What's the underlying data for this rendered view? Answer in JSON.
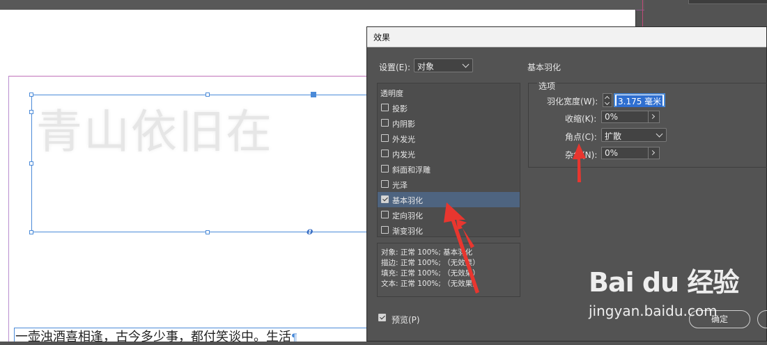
{
  "document": {
    "feathered_text": "青山依旧在",
    "body_text": "一壶浊酒喜相逢，古今多少事，都付笑谈中。生活",
    "paragraph_mark": "¶",
    "anchor_mark": "o"
  },
  "dialog": {
    "title": "效果",
    "settings_label": "设置(E):",
    "settings_value": "对象",
    "section_title": "基本羽化",
    "effects": [
      {
        "label": "透明度",
        "checked": null,
        "selected": false
      },
      {
        "label": "投影",
        "checked": false,
        "selected": false
      },
      {
        "label": "内阴影",
        "checked": false,
        "selected": false
      },
      {
        "label": "外发光",
        "checked": false,
        "selected": false
      },
      {
        "label": "内发光",
        "checked": false,
        "selected": false
      },
      {
        "label": "斜面和浮雕",
        "checked": false,
        "selected": false
      },
      {
        "label": "光泽",
        "checked": false,
        "selected": false
      },
      {
        "label": "基本羽化",
        "checked": true,
        "selected": true
      },
      {
        "label": "定向羽化",
        "checked": false,
        "selected": false
      },
      {
        "label": "渐变羽化",
        "checked": false,
        "selected": false
      }
    ],
    "summary": [
      "对象: 正常 100%; 基本羽化",
      "描边: 正常 100%; （无效果）",
      "填充: 正常 100%; （无效果）",
      "文本: 正常 100%; （无效果）"
    ],
    "options": {
      "group_label": "选项",
      "feather_width_label": "羽化宽度(W):",
      "feather_width_value": "3.175 毫米",
      "choke_label": "收缩(K):",
      "choke_value": "0%",
      "corners_label": "角点(C):",
      "corners_value": "扩散",
      "noise_label": "杂色(N):",
      "noise_value": "0%"
    },
    "preview_label": "预览(P)",
    "preview_checked": true,
    "ok_label": "确定"
  },
  "watermark": {
    "brand": "Bai du 经验",
    "url": "jingyan.baidu.com"
  },
  "colors": {
    "selection": "#4e6480",
    "arrow": "#e8362f",
    "frame": "#4a8ad8"
  }
}
